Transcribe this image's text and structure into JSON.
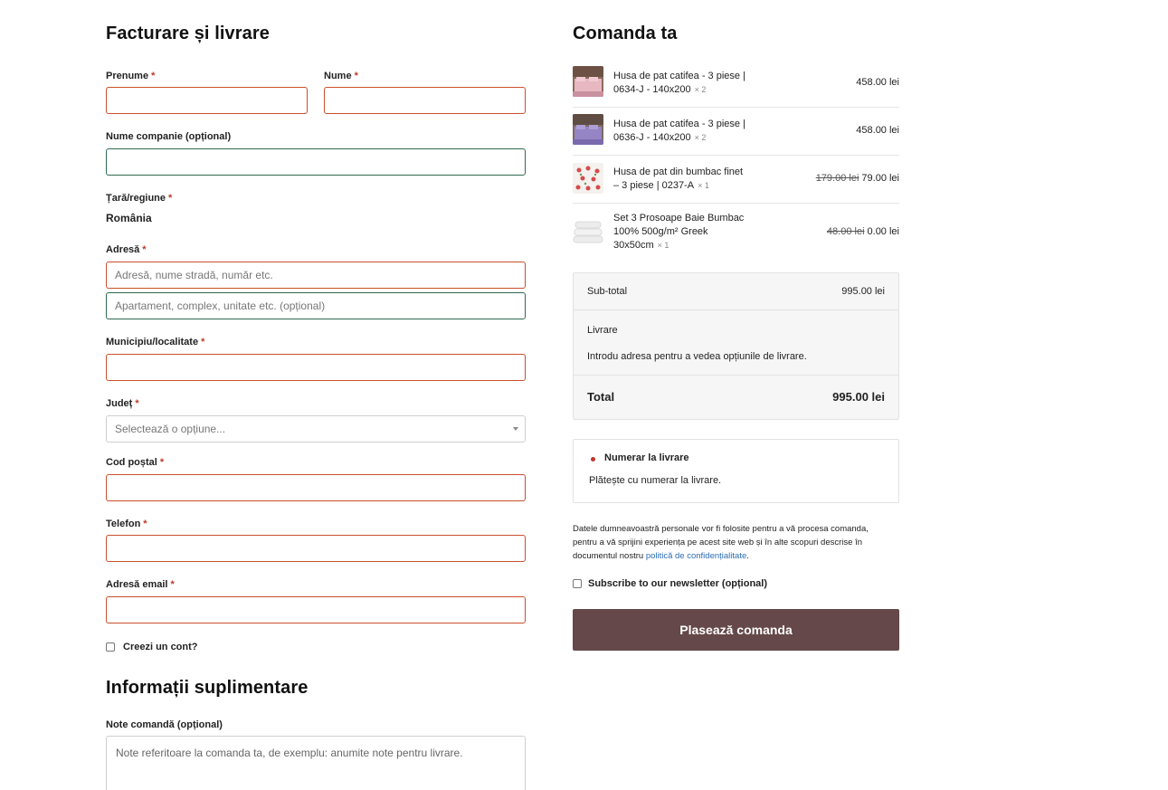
{
  "billing": {
    "title": "Facturare și livrare",
    "first_name_label": "Prenume",
    "last_name_label": "Nume",
    "company_label": "Nume companie (opțional)",
    "country_label": "Țară/regiune",
    "country_value": "România",
    "address_label": "Adresă",
    "address1_placeholder": "Adresă, nume stradă, număr etc.",
    "address2_placeholder": "Apartament, complex, unitate etc. (opțional)",
    "city_label": "Municipiu/localitate",
    "county_label": "Județ",
    "county_placeholder": "Selectează o opțiune...",
    "postcode_label": "Cod poștal",
    "phone_label": "Telefon",
    "email_label": "Adresă email",
    "required_mark": "*",
    "create_account_label": "Creezi un cont?"
  },
  "additional": {
    "title": "Informații suplimentare",
    "notes_label": "Note comandă (opțional)",
    "notes_placeholder": "Note referitoare la comanda ta, de exemplu: anumite note pentru livrare."
  },
  "order": {
    "title": "Comanda ta",
    "items": [
      {
        "name": "Husa de pat catifea - 3 piese | 0634-J - 140x200",
        "qty": "× 2",
        "old_price": "",
        "price": "458.00 lei"
      },
      {
        "name": "Husa de pat catifea - 3 piese | 0636-J - 140x200",
        "qty": "× 2",
        "old_price": "",
        "price": "458.00 lei"
      },
      {
        "name": "Husa de pat din bumbac finet – 3 piese | 0237-A",
        "qty": "× 1",
        "old_price": "179.00 lei",
        "price": "79.00 lei"
      },
      {
        "name": "Set 3 Prosoape Baie Bumbac 100% 500g/m² Greek 30x50cm",
        "qty": "× 1",
        "old_price": "48.00 lei",
        "price": "0.00 lei"
      }
    ],
    "subtotal_label": "Sub-total",
    "subtotal_value": "995.00 lei",
    "shipping_label": "Livrare",
    "shipping_note": "Introdu adresa pentru a vedea opțiunile de livrare.",
    "total_label": "Total",
    "total_value": "995.00 lei",
    "payment_title": "Numerar la livrare",
    "payment_desc": "Plătește cu numerar la livrare.",
    "privacy_text": "Datele dumneavoastră personale vor fi folosite pentru a vă procesa comanda, pentru a vă sprijini experiența pe acest site web și în alte scopuri descrise în documentul nostru",
    "privacy_link": "politică de confidențialitate",
    "privacy_end": ".",
    "newsletter_label": "Subscribe to our newsletter (opțional)",
    "place_order_label": "Plasează comanda"
  },
  "colors": {
    "error_border": "#c8502c",
    "valid_border": "#2e6b4f",
    "button_bg": "#654849",
    "link": "#2b6cb0",
    "required": "#c0392b"
  }
}
